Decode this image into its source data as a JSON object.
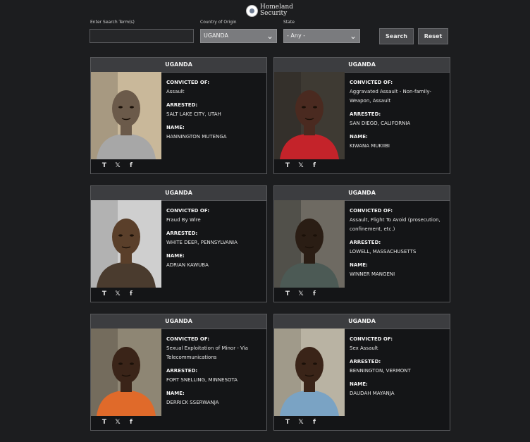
{
  "header": {
    "logo_text_line1": "Homeland",
    "logo_text_line2": "Security"
  },
  "filters": {
    "search_label": "Enter Search Term(s)",
    "search_value": "",
    "country_label": "Country of Origin",
    "country_value": "UGANDA",
    "state_label": "State",
    "state_value": "- Any -",
    "search_button": "Search",
    "reset_button": "Reset"
  },
  "labels": {
    "convicted": "CONVICTED OF:",
    "arrested": "ARRESTED:",
    "name": "NAME:"
  },
  "share_icons": [
    "truth-social-icon",
    "x-icon",
    "facebook-icon"
  ],
  "cards": [
    {
      "country": "UGANDA",
      "convicted_of": "Assault",
      "arrested": "SALT LAKE CITY, UTAH",
      "name": "HANNINGTON MUTENGA"
    },
    {
      "country": "UGANDA",
      "convicted_of": "Aggravated Assault - Non-family-Weapon, Assault",
      "arrested": "SAN DIEGO, CALIFORNIA",
      "name": "KIWANA MUKIIBI"
    },
    {
      "country": "UGANDA",
      "convicted_of": "Fraud By Wire",
      "arrested": "WHITE DEER, PENNSYLVANIA",
      "name": "ADRIAN KAWUBA"
    },
    {
      "country": "UGANDA",
      "convicted_of": "Assault, Flight To Avoid (prosecution, confinement, etc.)",
      "arrested": "LOWELL, MASSACHUSETTS",
      "name": "WINNER MANGENI"
    },
    {
      "country": "UGANDA",
      "convicted_of": "Sexual Exploitation of Minor - Via Telecommunications",
      "arrested": "FORT SNELLING, MINNESOTA",
      "name": "DERRICK SSERWANJA"
    },
    {
      "country": "UGANDA",
      "convicted_of": "Sex Assault",
      "arrested": "BENNINGTON, VERMONT",
      "name": "DAUDAH MAYANJA"
    }
  ]
}
